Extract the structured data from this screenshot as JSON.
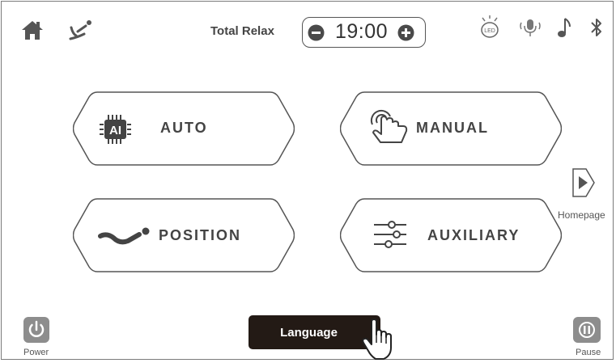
{
  "topbar": {
    "home_icon": "home-icon",
    "recline_icon": "recline-chair-icon",
    "program_label": "Total Relax",
    "timer": {
      "value": "19:00",
      "minus_icon": "minus-circle-icon",
      "plus_icon": "plus-circle-icon"
    },
    "right_icons": [
      "led-light-icon",
      "voice-microphone-icon",
      "music-note-icon",
      "bluetooth-icon"
    ],
    "led_text": "LED"
  },
  "modes": {
    "auto": {
      "label": "AUTO",
      "badge_text": "AI",
      "icon": "ai-chip-icon"
    },
    "manual": {
      "label": "MANUAL",
      "icon": "touch-hand-icon"
    },
    "position": {
      "label": "POSITION",
      "icon": "reclined-body-icon"
    },
    "auxiliary": {
      "label": "AUXILIARY",
      "icon": "sliders-icon"
    }
  },
  "homepage": {
    "label": "Homepage",
    "icon": "play-arrow-icon"
  },
  "bottom": {
    "power_label": "Power",
    "pause_label": "Pause",
    "language_label": "Language",
    "pointer_icon": "pointer-hand-icon"
  },
  "colors": {
    "line": "#555555",
    "text": "#444444",
    "language_bg": "#231a15",
    "icon_gray": "#888888"
  }
}
